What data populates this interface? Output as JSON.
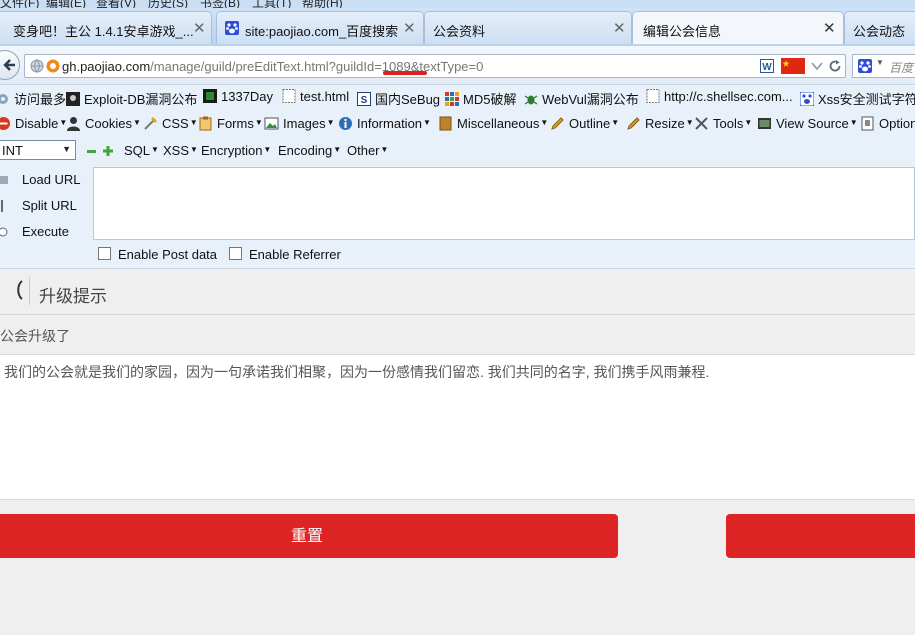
{
  "menu": {
    "items": [
      "文件(F)",
      "编辑(E)",
      "查看(V)",
      "历史(S)",
      "书签(B)",
      "工具(T)",
      "帮助(H)"
    ]
  },
  "tabs": [
    {
      "label": "变身吧！主公 1.4.1安卓游戏_...",
      "icon": "page-icon",
      "close": "✕"
    },
    {
      "label": "site:paojiao.com_百度搜索",
      "icon": "baidu-paw-icon",
      "close": "✕"
    },
    {
      "label": "公会资料",
      "icon": "",
      "close": "✕"
    },
    {
      "label": "编辑公会信息",
      "icon": "",
      "close": "✕"
    },
    {
      "label": "公会动态",
      "icon": "",
      "close": ""
    }
  ],
  "nav": {
    "url_domain": "gh.paojiao.com",
    "url_path": "/manage/guild/preEditText.html?guildId=",
    "url_highlight": "1089",
    "url_tail": "&textType=0",
    "search_placeholder": "百度",
    "underline_color": "#e0201c"
  },
  "bookmarks": [
    {
      "label": "访问最多",
      "icon": "gear-icon"
    },
    {
      "label": "Exploit-DB漏洞公布",
      "icon": "exploitdb-icon"
    },
    {
      "label": "1337Day",
      "icon": "1337day-icon"
    },
    {
      "label": "test.html",
      "icon": "page-icon"
    },
    {
      "label": "国内SeBug",
      "icon": "sebug-icon"
    },
    {
      "label": "MD5破解",
      "icon": "grid-icon"
    },
    {
      "label": "WebVul漏洞公布",
      "icon": "bug-icon"
    },
    {
      "label": "http://c.shellsec.com...",
      "icon": "page-icon"
    },
    {
      "label": "Xss安全测试字符",
      "icon": "baidu-paw-icon"
    }
  ],
  "webdev": [
    {
      "label": "Disable",
      "icon": "disable-icon"
    },
    {
      "label": "Cookies",
      "icon": "cookie-icon"
    },
    {
      "label": "CSS",
      "icon": "css-icon"
    },
    {
      "label": "Forms",
      "icon": "forms-icon"
    },
    {
      "label": "Images",
      "icon": "images-icon"
    },
    {
      "label": "Information",
      "icon": "info-icon"
    },
    {
      "label": "Miscellaneous",
      "icon": "misc-icon"
    },
    {
      "label": "Outline",
      "icon": "pencil-icon"
    },
    {
      "label": "Resize",
      "icon": "resize-icon"
    },
    {
      "label": "Tools",
      "icon": "tools-icon"
    },
    {
      "label": "View Source",
      "icon": "view-source-icon"
    },
    {
      "label": "Options",
      "icon": "options-icon"
    }
  ],
  "hackbar": {
    "select_value": "INT",
    "menus": [
      "SQL",
      "XSS",
      "Encryption",
      "Encoding",
      "Other"
    ],
    "actions": [
      "Load URL",
      "Split URL",
      "Execute"
    ],
    "checkboxes": [
      "Enable Post data",
      "Enable Referrer"
    ]
  },
  "page": {
    "title": "升级提示",
    "label": "公会升级了",
    "body_text": "我们的公会就是我们的家园，因为一句承诺我们相聚，因为一份感情我们留恋. 我们共同的名字, 我们携手风雨兼程.",
    "reset_button": "重置",
    "accent_color": "#dd2525"
  }
}
